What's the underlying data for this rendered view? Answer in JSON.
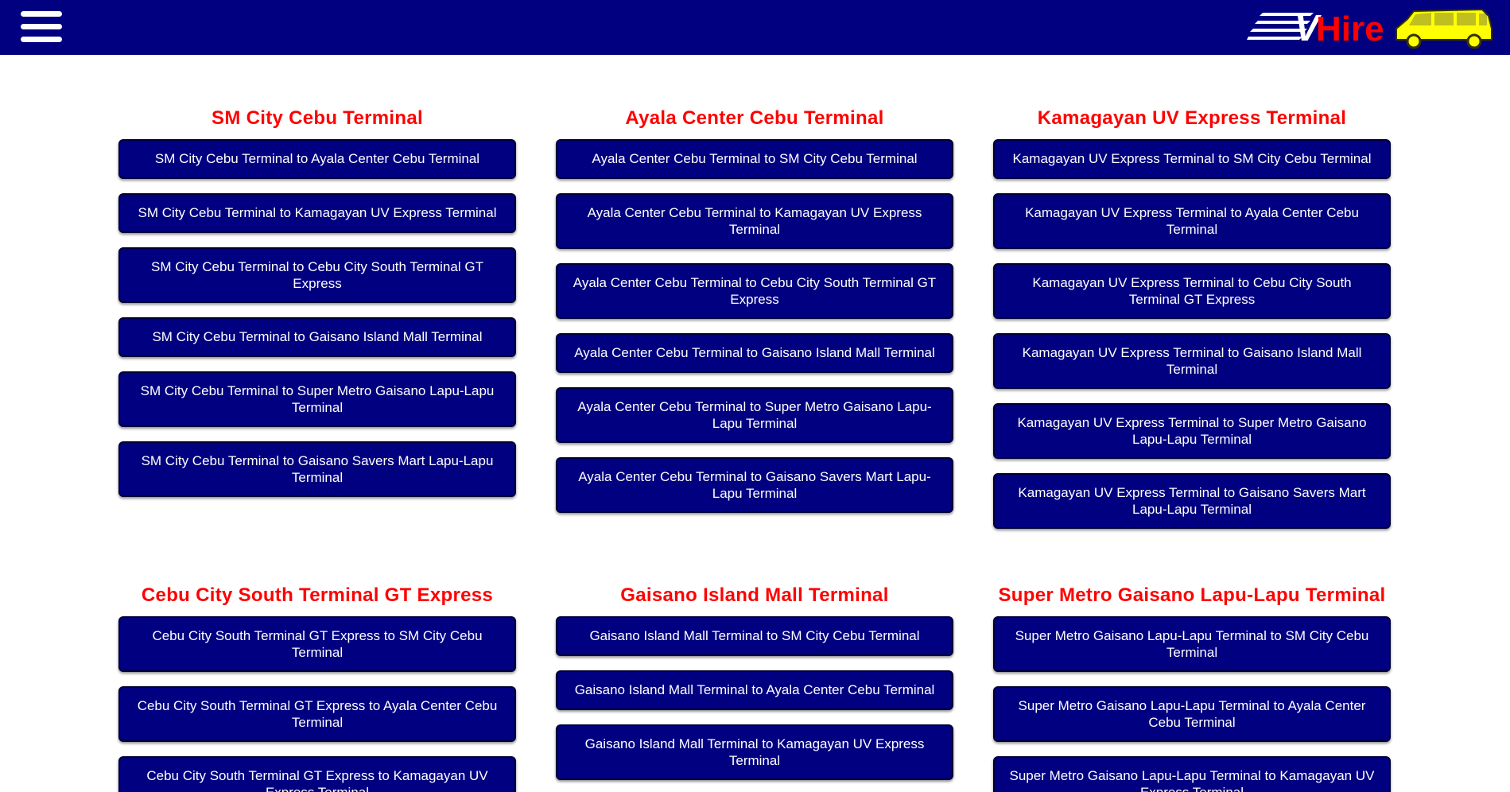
{
  "header": {
    "logo_text": "Hire",
    "logo_letter": "V",
    "colors": {
      "bar": "#000080",
      "logo_red": "#ff0000",
      "van_yellow": "#ffff00"
    }
  },
  "sections": [
    {
      "columns": [
        {
          "title": "SM City Cebu Terminal",
          "routes": [
            "SM City Cebu Terminal to Ayala Center Cebu Terminal",
            "SM City Cebu Terminal to Kamagayan UV Express Terminal",
            "SM City Cebu Terminal to Cebu City South Terminal GT Express",
            "SM City Cebu Terminal to Gaisano Island Mall Terminal",
            "SM City Cebu Terminal to Super Metro Gaisano Lapu-Lapu Terminal",
            "SM City Cebu Terminal to Gaisano Savers Mart Lapu-Lapu Terminal"
          ]
        },
        {
          "title": "Ayala Center Cebu Terminal",
          "routes": [
            "Ayala Center Cebu Terminal to SM City Cebu Terminal",
            "Ayala Center Cebu Terminal to Kamagayan UV Express Terminal",
            "Ayala Center Cebu Terminal to Cebu City South Terminal GT Express",
            "Ayala Center Cebu Terminal to Gaisano Island Mall Terminal",
            "Ayala Center Cebu Terminal to Super Metro Gaisano Lapu-Lapu Terminal",
            "Ayala Center Cebu Terminal to Gaisano Savers Mart Lapu-Lapu Terminal"
          ]
        },
        {
          "title": "Kamagayan UV Express Terminal",
          "routes": [
            "Kamagayan UV Express Terminal to SM City Cebu Terminal",
            "Kamagayan UV Express Terminal to Ayala Center Cebu Terminal",
            "Kamagayan UV Express Terminal to Cebu City South Terminal GT Express",
            "Kamagayan UV Express Terminal to Gaisano Island Mall Terminal",
            "Kamagayan UV Express Terminal to Super Metro Gaisano Lapu-Lapu Terminal",
            "Kamagayan UV Express Terminal to Gaisano Savers Mart Lapu-Lapu Terminal"
          ]
        }
      ]
    },
    {
      "columns": [
        {
          "title": "Cebu City South Terminal GT Express",
          "routes": [
            "Cebu City South Terminal GT Express to SM City Cebu Terminal",
            "Cebu City South Terminal GT Express to Ayala Center Cebu Terminal",
            "Cebu City South Terminal GT Express to Kamagayan UV Express Terminal"
          ]
        },
        {
          "title": "Gaisano Island Mall Terminal",
          "routes": [
            "Gaisano Island Mall Terminal to SM City Cebu Terminal",
            "Gaisano Island Mall Terminal to Ayala Center Cebu Terminal",
            "Gaisano Island Mall Terminal to Kamagayan UV Express Terminal"
          ]
        },
        {
          "title": "Super Metro Gaisano Lapu-Lapu Terminal",
          "routes": [
            "Super Metro Gaisano Lapu-Lapu Terminal to SM City Cebu Terminal",
            "Super Metro Gaisano Lapu-Lapu Terminal to Ayala Center Cebu Terminal",
            "Super Metro Gaisano Lapu-Lapu Terminal to Kamagayan UV Express Terminal"
          ]
        }
      ]
    }
  ]
}
